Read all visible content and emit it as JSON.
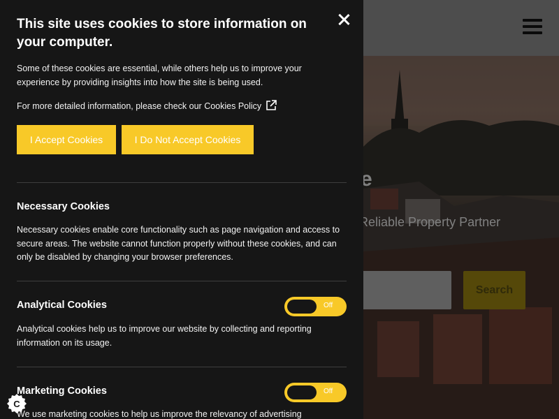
{
  "site": {
    "search_button": "Search",
    "hero_title_fragment": "e",
    "hero_subtitle_fragment": "Reliable Property Partner"
  },
  "cookie_panel": {
    "title": "This site uses cookies to store information on your computer.",
    "intro": "Some of these cookies are essential, while others help us to improve your experience by providing insights into how the site is being used.",
    "policy_text": "For more detailed information, please check our Cookies Policy",
    "accept_label": "I Accept Cookies",
    "decline_label": "I Do Not Accept Cookies",
    "sections": [
      {
        "title": "Necessary Cookies",
        "description": "Necessary cookies enable core functionality such as page navigation and access to secure areas. The website cannot function properly without these cookies, and can only be disabled by changing your browser preferences."
      },
      {
        "title": "Analytical Cookies",
        "description": "Analytical cookies help us to improve our website by collecting and reporting information on its usage.",
        "toggle": "Off"
      },
      {
        "title": "Marketing Cookies",
        "description": "We use marketing cookies to help us improve the relevancy of advertising",
        "toggle": "Off"
      }
    ]
  },
  "colors": {
    "accent": "#f8c928",
    "panel_bg": "#161616"
  },
  "icons": {
    "close": "close-icon",
    "external": "external-link-icon",
    "menu": "hamburger-menu-icon",
    "cookie": "cookie-icon"
  }
}
